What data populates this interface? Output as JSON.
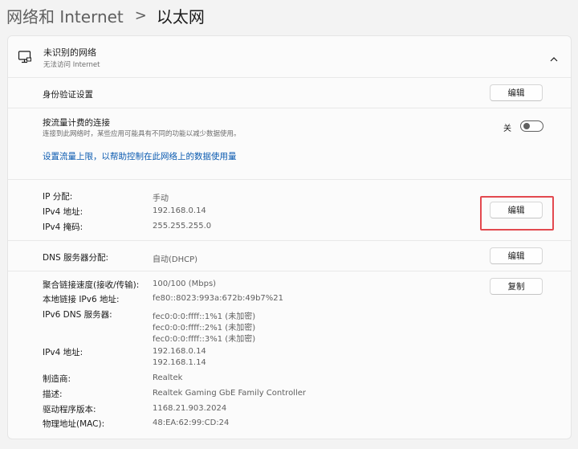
{
  "breadcrumb": {
    "parent": "网络和 Internet",
    "separator": ">",
    "current": "以太网"
  },
  "network": {
    "name": "未识别的网络",
    "status": "无法访问 Internet",
    "icon": "monitor-network-icon",
    "collapse_icon": "chevron-up-icon"
  },
  "auth": {
    "label": "身份验证设置",
    "button": "编辑"
  },
  "metered": {
    "label": "按流量计费的连接",
    "description": "连接到此网络时，某些应用可能具有不同的功能以减少数据使用。",
    "toggle_state": "关",
    "toggle_on": false,
    "link": "设置流量上限，以帮助控制在此网络上的数据使用量"
  },
  "ip_assignment": {
    "rows": [
      {
        "label": "IP 分配:",
        "value": "手动"
      },
      {
        "label": "IPv4 地址:",
        "value": "192.168.0.14"
      },
      {
        "label": "IPv4 掩码:",
        "value": "255.255.255.0"
      }
    ],
    "button": "编辑"
  },
  "dns_assignment": {
    "label": "DNS 服务器分配:",
    "value": "自动(DHCP)",
    "button": "编辑"
  },
  "properties": {
    "copy_button": "复制",
    "rows": [
      {
        "label": "聚合链接速度(接收/传输):",
        "values": [
          "100/100 (Mbps)"
        ]
      },
      {
        "label": "本地链接 IPv6 地址:",
        "values": [
          "fe80::8023:993a:672b:49b7%21"
        ]
      },
      {
        "label": "IPv6 DNS 服务器:",
        "values": [
          "fec0:0:0:ffff::1%1 (未加密)",
          "fec0:0:0:ffff::2%1 (未加密)",
          "fec0:0:0:ffff::3%1 (未加密)"
        ]
      },
      {
        "label": "IPv4 地址:",
        "values": [
          "192.168.0.14",
          "192.168.1.14"
        ]
      },
      {
        "label": "制造商:",
        "values": [
          "Realtek"
        ]
      },
      {
        "label": "描述:",
        "values": [
          "Realtek Gaming GbE Family Controller"
        ]
      },
      {
        "label": "驱动程序版本:",
        "values": [
          "1168.21.903.2024"
        ]
      },
      {
        "label": "物理地址(MAC):",
        "values": [
          "48:EA:62:99:CD:24"
        ]
      }
    ]
  },
  "colors": {
    "accent_link": "#0a5ab0",
    "highlight_box": "#e3494f",
    "card_bg": "#fbfbfb",
    "page_bg": "#f3f3f3"
  }
}
